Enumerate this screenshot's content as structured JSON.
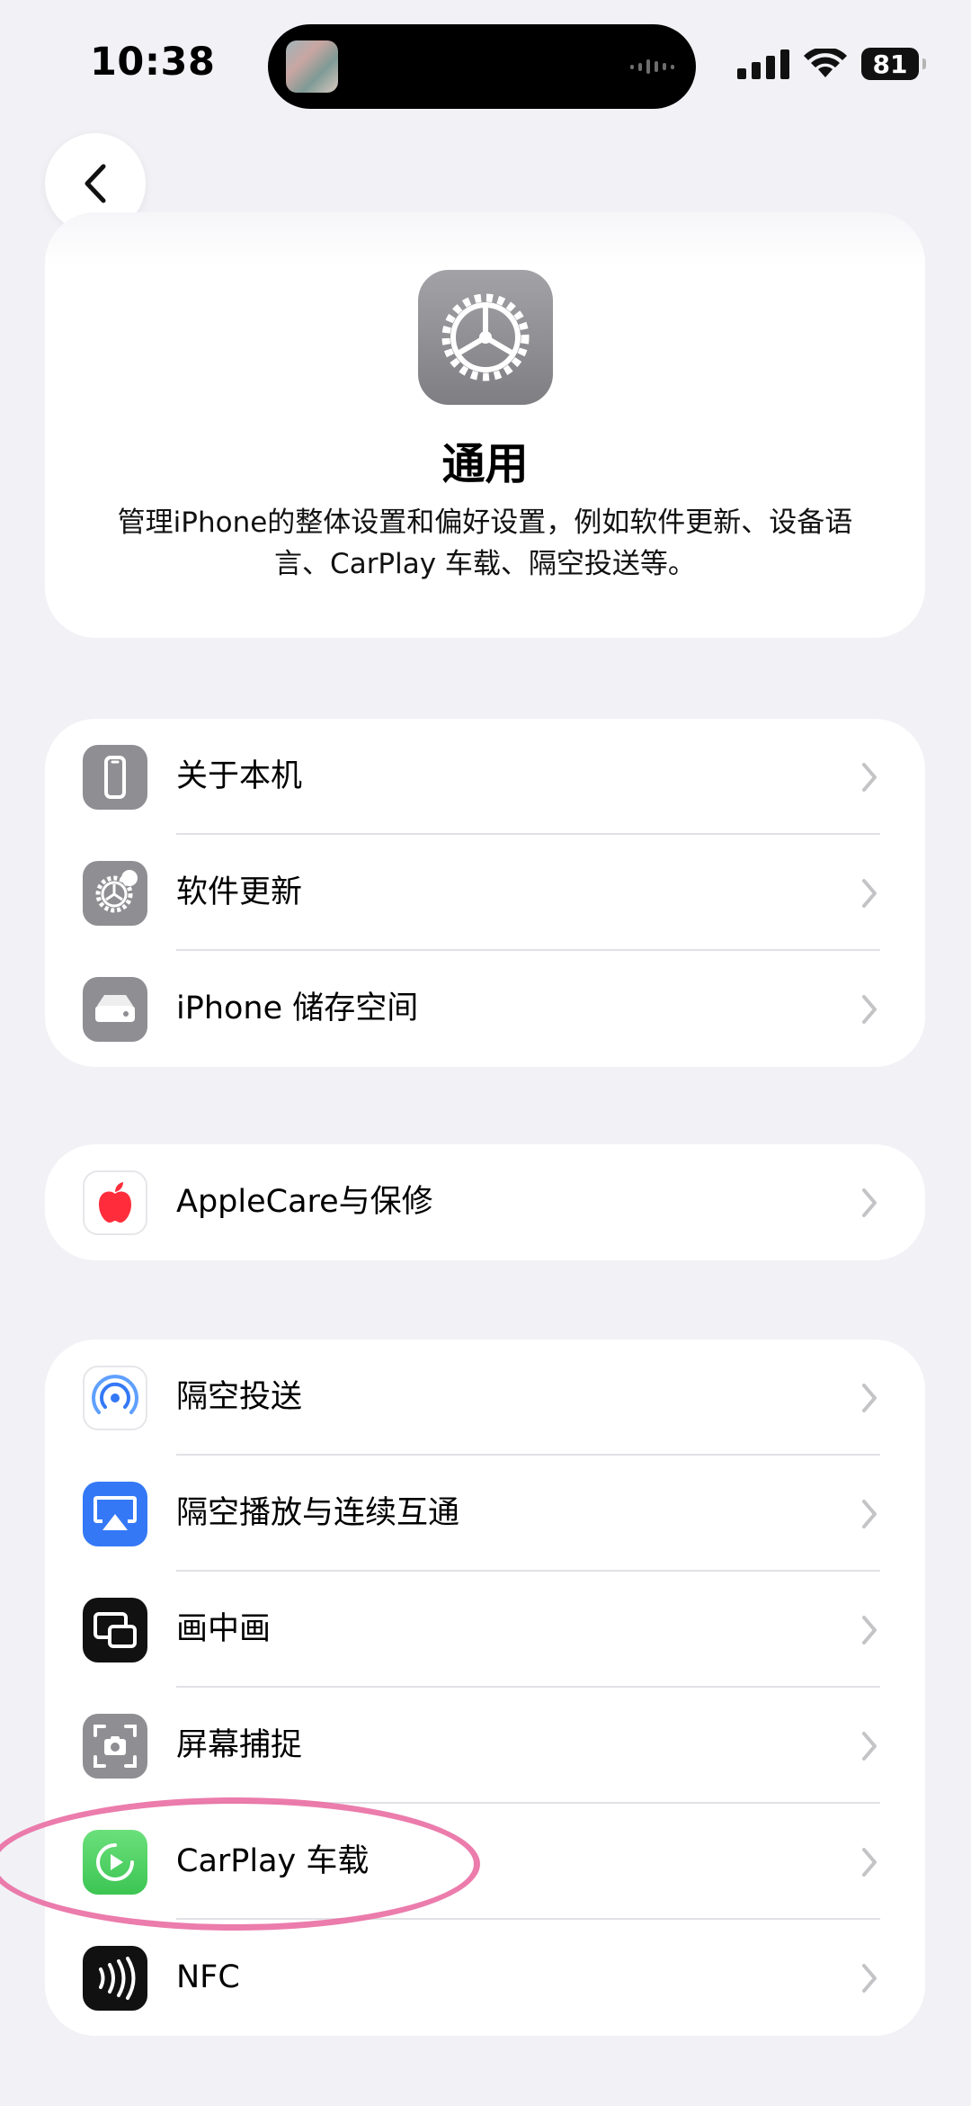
{
  "status_bar": {
    "time": "10:38",
    "battery": "81"
  },
  "header": {
    "title": "通用",
    "description": "管理iPhone的整体设置和偏好设置，例如软件更新、设备语言、CarPlay 车载、隔空投送等。",
    "icon": "gear-icon"
  },
  "groups": [
    {
      "items": [
        {
          "label": "关于本机",
          "icon": "phone-icon"
        },
        {
          "label": "软件更新",
          "icon": "gear-badge-icon"
        },
        {
          "label": "iPhone 储存空间",
          "icon": "storage-icon"
        }
      ]
    },
    {
      "items": [
        {
          "label": "AppleCare与保修",
          "icon": "apple-icon"
        }
      ]
    },
    {
      "items": [
        {
          "label": "隔空投送",
          "icon": "airdrop-icon"
        },
        {
          "label": "隔空播放与连续互通",
          "icon": "airplay-icon"
        },
        {
          "label": "画中画",
          "icon": "picture-in-picture-icon"
        },
        {
          "label": "屏幕捕捉",
          "icon": "screen-capture-icon"
        },
        {
          "label": "CarPlay 车载",
          "icon": "carplay-icon"
        },
        {
          "label": "NFC",
          "icon": "nfc-icon"
        }
      ]
    }
  ],
  "colors": {
    "background": "#f1f1f6",
    "card": "#ffffff",
    "gray_icon": "#8e8e93",
    "airplay_blue": "#3478f6",
    "carplay_green": "#4cd964",
    "apple_red": "#ff2d3b",
    "highlight": "#e86aa0"
  }
}
